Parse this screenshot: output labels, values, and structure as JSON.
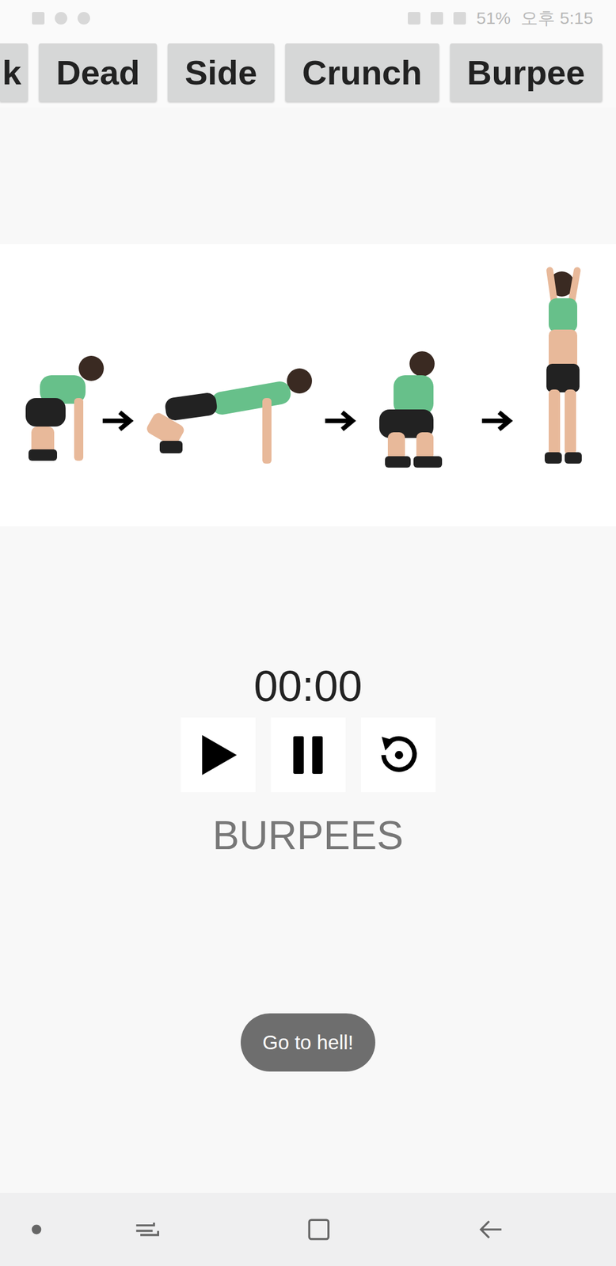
{
  "status_bar": {
    "battery": "51%",
    "time": "오후 5:15"
  },
  "tabs": [
    {
      "label": "k"
    },
    {
      "label": "Dead"
    },
    {
      "label": "Side"
    },
    {
      "label": "Crunch"
    },
    {
      "label": "Burpee"
    }
  ],
  "timer": {
    "time": "00:00"
  },
  "exercise_name": "BURPEES",
  "toast": "Go to hell!"
}
